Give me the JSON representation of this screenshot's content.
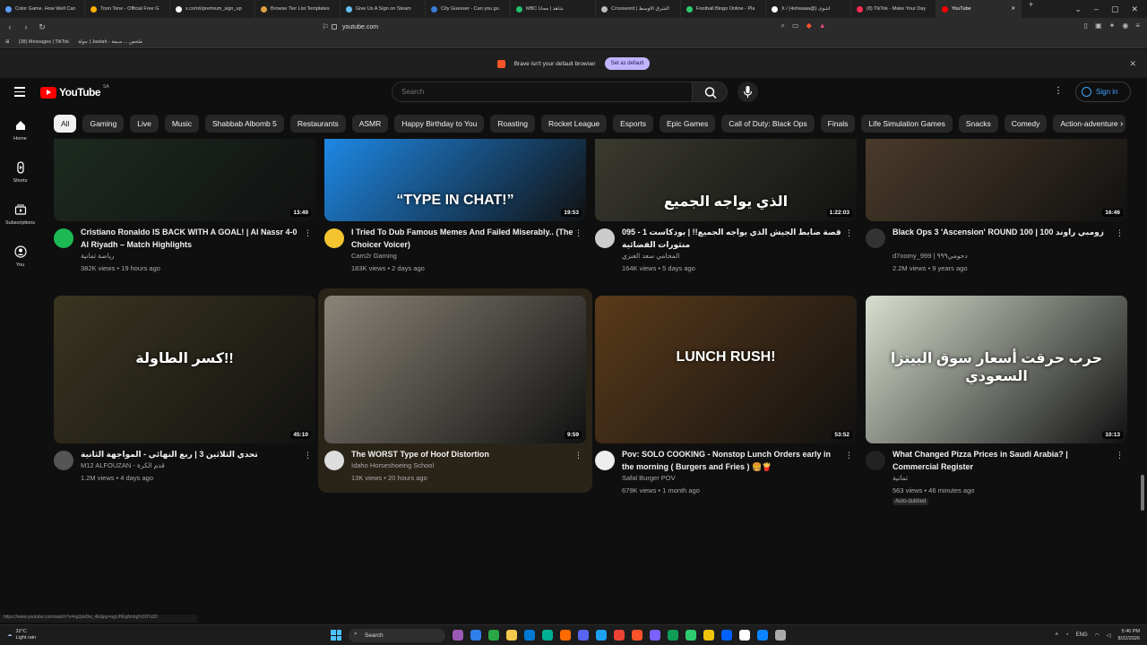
{
  "browser": {
    "tabs": [
      {
        "title": "Color Game. How Well Can",
        "color": "#5aa0ff"
      },
      {
        "title": "Toon Tone - Official Free G",
        "color": "#ffb000"
      },
      {
        "title": "x.com/i/premium_sign_up",
        "color": "#ffffff"
      },
      {
        "title": "Browse Tier List Templates",
        "color": "#e0a040"
      },
      {
        "title": "Give Us A Sign on Steam",
        "color": "#66c0f4"
      },
      {
        "title": "City Guesser - Can you gu",
        "color": "#3a7bd5"
      },
      {
        "title": "MBC شاهد | مجاناً",
        "color": "#21c06a"
      },
      {
        "title": "Crossword | الشرق الأوسط",
        "color": "#bbbbbb"
      },
      {
        "title": "Football Bingo Online - Pla",
        "color": "#2ecc71"
      },
      {
        "title": "X / (4shwaaa@) اشوى",
        "color": "#ffffff"
      },
      {
        "title": "(8) TikTok - Make Your Day",
        "color": "#ff2d55"
      },
      {
        "title": "YouTube",
        "color": "#ff0000",
        "active": true
      }
    ],
    "url": "youtube.com",
    "bookmarks": [
      "(38) Messages | TikTok",
      "جولة | Jawlah - ملخص ... سبعة"
    ],
    "infobar": {
      "text": "Brave isn't your default browser",
      "button": "Set as default"
    },
    "status_url": "https://www.youtube.com/watch?v=kg2pkDw_4E&pp=ugUHEgNnbg%3D%3D"
  },
  "youtube": {
    "logo_text": "YouTube",
    "country": "SA",
    "search_placeholder": "Search",
    "signin": "Sign in",
    "rail": [
      {
        "icon": "home-icon",
        "label": "Home"
      },
      {
        "icon": "shorts-icon",
        "label": "Shorts"
      },
      {
        "icon": "subscriptions-icon",
        "label": "Subscriptions"
      },
      {
        "icon": "you-icon",
        "label": "You"
      }
    ],
    "chips": [
      "All",
      "Gaming",
      "Live",
      "Music",
      "Shabbab Albomb 5",
      "Restaurants",
      "ASMR",
      "Happy Birthday to You",
      "Roasting",
      "Rocket League",
      "Esports",
      "Epic Games",
      "Call of Duty: Black Ops",
      "Finals",
      "Life Simulation Games",
      "Snacks",
      "Comedy",
      "Action-adventure"
    ],
    "row1": [
      {
        "title": "Cristiano Ronaldo IS BACK WITH A GOAL! | Al Nassr 4-0 Al Riyadh – Match Highlights",
        "channel": "رياضة ثمانية",
        "views": "382K views • 19 hours ago",
        "duration": "13:49",
        "thumb": "#1d2a20",
        "avatar": "#1db954"
      },
      {
        "title": "I Tried To Dub Famous Memes And Failed Miserably.. (The Choicer Voicer)",
        "channel": "Cam2r Gaming",
        "views": "183K views • 2 days ago",
        "duration": "19:53",
        "thumb": "#1e88e5",
        "avatar": "#f4c430",
        "thumb_text": "“TYPE IN CHAT!”"
      },
      {
        "title": "095 - 1 قصة ضابط الجيش الذي يواجه الجميع!! | بودكاست منثورات الفضائية",
        "channel": "المحامي سعد العنزي",
        "views": "164K views • 5 days ago",
        "duration": "1:22:03",
        "thumb": "#3a3a30",
        "avatar": "#ccc",
        "thumb_text": "الذي يواجه الجميع"
      },
      {
        "title": "Black Ops 3 'Ascension' ROUND 100 | زومبي راوند 100",
        "channel": "d7oomy_999 | دحومي٩٩٩",
        "views": "2.2M views • 9 years ago",
        "duration": "16:46",
        "thumb": "#4a3a2a",
        "avatar": "#333"
      }
    ],
    "row2": [
      {
        "title": "تحدي الثلاثين 3 | ربع النهائي - المواجهة الثانية",
        "channel": "M12 ALFOUZAN - قدم الكرة",
        "views": "1.2M views • 4 days ago",
        "duration": "45:10",
        "thumb": "#3a3520",
        "avatar": "#555",
        "thumb_text": "كسر الطاولة!!"
      },
      {
        "title": "The WORST Type of Hoof Distortion",
        "channel": "Idaho Horseshoeing School",
        "views": "13K views • 20 hours ago",
        "duration": "9:59",
        "thumb": "#8a8478",
        "avatar": "#ddd"
      },
      {
        "title": "Pov: SOLO COOKING - Nonstop Lunch Orders early in the morning ( Burgers and Fries ) 🍔🍟",
        "channel": "Safal Burger POV",
        "views": "679K views • 1 month ago",
        "duration": "53:52",
        "thumb": "#5a3a1a",
        "avatar": "#eee",
        "thumb_text": "LUNCH RUSH!"
      },
      {
        "title": "What Changed Pizza Prices in Saudi Arabia? | Commercial Register",
        "channel": "ثمانية",
        "views": "563 views • 46 minutes ago",
        "duration": "10:13",
        "thumb": "#d8dfd0",
        "avatar": "#222",
        "badge": "Auto-dubbed",
        "thumb_text": "حرب حرقت أسعار سوق البيتزا السعودي"
      }
    ]
  },
  "taskbar": {
    "weather_temp": "32°C",
    "weather_desc": "Light rain",
    "search": "Search",
    "lang": "ENG",
    "time": "5:46 PM",
    "date": "8/22/2026"
  }
}
